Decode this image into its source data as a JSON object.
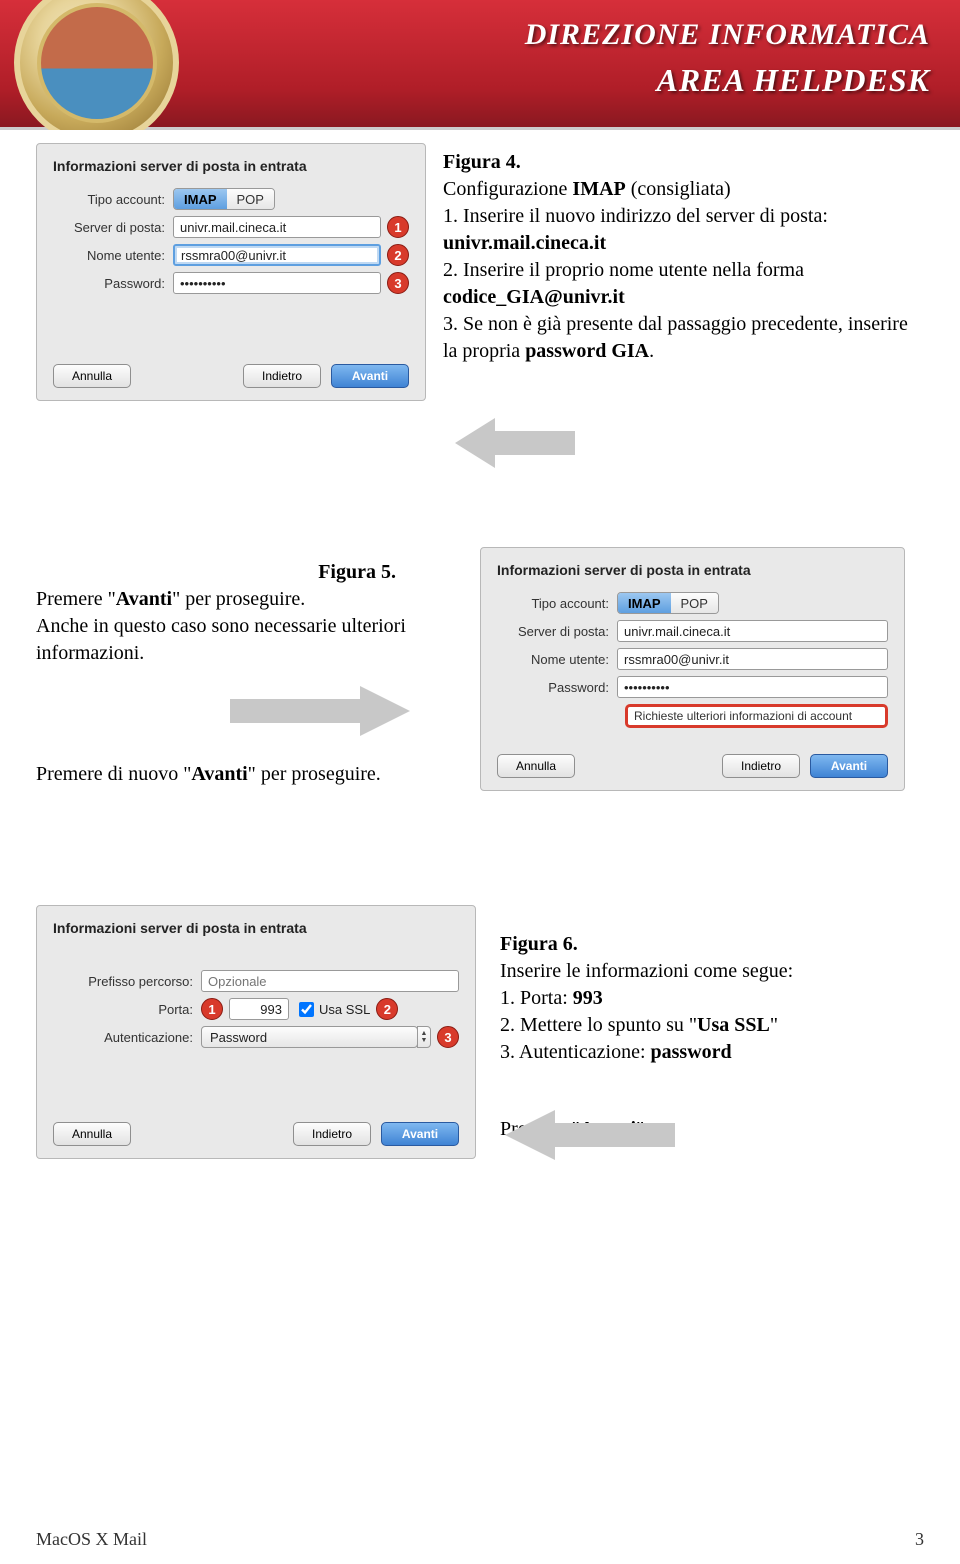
{
  "header": {
    "line1": "DIREZIONE INFORMATICA",
    "line2": "AREA HELPDESK"
  },
  "dlg1": {
    "title": "Informazioni server di posta in entrata",
    "labels": {
      "type": "Tipo account:",
      "server": "Server di posta:",
      "user": "Nome utente:",
      "pwd": "Password:"
    },
    "seg_imap": "IMAP",
    "seg_pop": "POP",
    "server": "univr.mail.cineca.it",
    "user": "rssmra00@univr.it",
    "pwd": "••••••••••",
    "btn_cancel": "Annulla",
    "btn_back": "Indietro",
    "btn_next": "Avanti"
  },
  "txt1": {
    "fig": "Figura 4.",
    "l1a": "Configurazione ",
    "l1b": "IMAP",
    "l1c": " (consigliata)",
    "l2a": "1. Inserire il nuovo indirizzo del server di posta: ",
    "l2b": "univr.mail.cineca.it",
    "l3a": "2. Inserire il proprio nome utente nella forma ",
    "l3b": "codice_GIA@univr.it",
    "l4a": "3. Se non è già presente dal passaggio precedente, inserire la propria ",
    "l4b": "password GIA",
    "l4c": "."
  },
  "txt2": {
    "fig": "Figura 5.",
    "l1a": "Premere \"",
    "l1b": "Avanti",
    "l1c": "\" per proseguire.",
    "l2": "Anche in questo caso sono necessarie ulteriori informazioni."
  },
  "txt3": {
    "l1a": "Premere di nuovo \"",
    "l1b": "Avanti",
    "l1c": "\" per proseguire."
  },
  "dlg2": {
    "title": "Informazioni server di posta in entrata",
    "labels": {
      "type": "Tipo account:",
      "server": "Server di posta:",
      "user": "Nome utente:",
      "pwd": "Password:"
    },
    "seg_imap": "IMAP",
    "seg_pop": "POP",
    "server": "univr.mail.cineca.it",
    "user": "rssmra00@univr.it",
    "pwd": "••••••••••",
    "warn": "Richieste ulteriori informazioni di account",
    "btn_cancel": "Annulla",
    "btn_back": "Indietro",
    "btn_next": "Avanti"
  },
  "dlg3": {
    "title": "Informazioni server di posta in entrata",
    "labels": {
      "prefix": "Prefisso percorso:",
      "port": "Porta:",
      "auth": "Autenticazione:"
    },
    "prefix_placeholder": "Opzionale",
    "port": "993",
    "ssl_label": "Usa SSL",
    "auth_value": "Password",
    "btn_cancel": "Annulla",
    "btn_back": "Indietro",
    "btn_next": "Avanti"
  },
  "txt4": {
    "fig": "Figura 6.",
    "l1": "Inserire le informazioni come segue:",
    "l2a": "1. Porta: ",
    "l2b": "993",
    "l3a": "2. Mettere lo spunto su \"",
    "l3b": "Usa SSL",
    "l3c": "\"",
    "l4a": "3. Autenticazione: ",
    "l4b": "password",
    "l5a": "Premere \"",
    "l5b": "Avanti",
    "l5c": "\"."
  },
  "badges": {
    "one": "1",
    "two": "2",
    "three": "3"
  },
  "footer": {
    "left": "MacOS X Mail",
    "right": "3"
  }
}
